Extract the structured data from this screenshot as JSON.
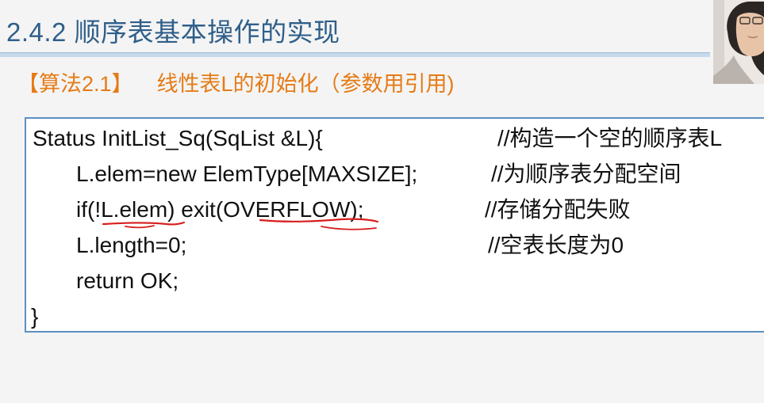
{
  "slide": {
    "title": "2.4.2 顺序表基本操作的实现",
    "algo_tag": "【算法2.1】",
    "algo_title": "线性表L的初始化（参数用引用)"
  },
  "code": {
    "lines": [
      "Status InitList_Sq(SqList &L){",
      "L.elem=new ElemType[MAXSIZE];",
      "if(!L.elem) exit(OVERFLOW);",
      "L.length=0;",
      "return OK;",
      "}"
    ],
    "comments": [
      "//构造一个空的顺序表L",
      "//为顺序表分配空间",
      "//存储分配失败",
      "//空表长度为0"
    ]
  },
  "colors": {
    "title": "#2f5f8a",
    "algo_heading": "#e57b16",
    "code_border": "#5c8fc2",
    "annotation_ink": "#d81e1e"
  },
  "presenter": {
    "icon": "presenter-webcam-thumbnail"
  }
}
